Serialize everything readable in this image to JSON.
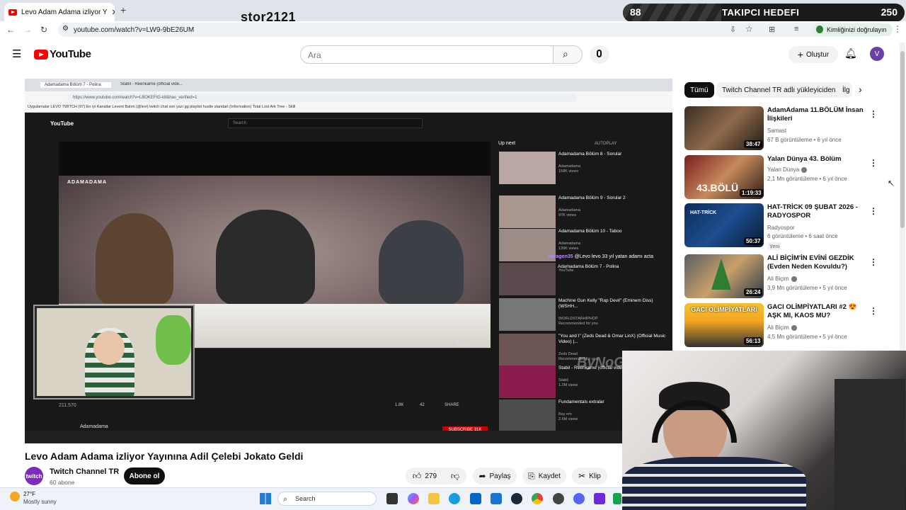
{
  "browser": {
    "tab_title": "Levo Adam Adama izliyor Y",
    "url": "youtube.com/watch?v=LW9-9bE26UM",
    "identity_chip": "Kimliğinizi doğrulayın"
  },
  "overlay": {
    "streamer_name": "stor2121",
    "follow_goal_label": "TAKIPCI HEDEFI",
    "follow_current": "88",
    "follow_target": "250",
    "follow_progress": 0.35
  },
  "youtube": {
    "logo": "YouTube",
    "search_placeholder": "Ara",
    "create_label": "Oluştur",
    "avatar_letter": "V"
  },
  "player": {
    "inner_url": "https://www.youtube.com/watch?v=LBOKEFIG-k8&has_verified=1",
    "inner_tab1": "Adamadama Bölüm 7 - Polina",
    "inner_tab2": "Stabil - Reenkarne (official vide...",
    "inner_bookmarks": "Uygulamalar   LEVO TWITCH   (97) En iyi Kanallar   Levent Balım (@levi)   twitch chat son yazı   gg   playlist   hustle standart   (Information) Total   Lost Ark Tree - Skill",
    "inner_search": "Search",
    "inner_logo": "YouTube",
    "up_next": "Up next",
    "autoplay": "AUTOPLAY",
    "sign": "ADAMADAMA",
    "watermark": "ByNoGame",
    "chat_line": "@Levo levo 33 yıl yatan adamı acta",
    "chat_user": "ravagen35",
    "chat_title": "Adamadama Bölüm 7 - Polina",
    "views_count": "211.570",
    "inner_channel": "Adamadama",
    "inner_likes": "1.8K",
    "inner_dislikes": "42",
    "inner_share": "SHARE",
    "inner_subscribe": "SUBSCRIBE 31K",
    "recs": [
      {
        "title": "Adamadama Bölüm 8 - Sorular",
        "sub": "Adamadama\n158K views",
        "dur": "15:35"
      },
      {
        "title": "Adamadama Bölüm 9 - Sorular 2",
        "sub": "Adamadama\n97K views",
        "dur": "8:29"
      },
      {
        "title": "Adamadama Bölüm 10 - Taboo",
        "sub": "Adamadama\n139K views",
        "dur": ""
      },
      {
        "title": "",
        "sub": "YouTube",
        "dur": "50+"
      },
      {
        "title": "Machine Gun Kelly \"Rap Devil\" (Eminem Diss) (WSHH...",
        "sub": "WORLDSTARHIPHOP\nRecommended for you",
        "dur": "4:48"
      },
      {
        "title": "\"You and I\" (Zeds Dead & Omar LinX) (Official Music Video) |...",
        "sub": "Zeds Dead\nRecommended for you",
        "dur": "4:18"
      },
      {
        "title": "Stabil - Reenkarne (official video)",
        "sub": "Stabil\n1.2M views",
        "dur": "5:22"
      },
      {
        "title": "Fundamentals extralar",
        "sub": "Bay em\n2.6M views",
        "dur": "35:58"
      }
    ]
  },
  "video": {
    "title": "Levo Adam Adama izliyor Yayınına Adil Çelebi Jokato Geldi",
    "channel_name": "Twitch Channel TR",
    "channel_subs": "60 abone",
    "channel_avatar_text": "twitch",
    "subscribe_label": "Abone ol",
    "like_count": "279",
    "share_label": "Paylaş",
    "save_label": "Kaydet",
    "clip_label": "Klip"
  },
  "filters": [
    "Tümü",
    "Twitch Channel TR adlı yükleyiciden",
    "İlg"
  ],
  "sidebar": [
    {
      "title": "AdamAdama 11.BÖLÜM İnsan İlişkileri",
      "channel": "Samast",
      "meta": "67 B görüntüleme • 6 yıl önce",
      "duration": "38:47",
      "verified": false,
      "badge": ""
    },
    {
      "title": "Yalan Dünya 43. Bölüm",
      "channel": "Yalan Dünya",
      "meta": "2,1 Mn görüntüleme • 6 yıl önce",
      "duration": "1:19:33",
      "verified": true,
      "badge": "",
      "thumb_text": "43.BÖLÜ"
    },
    {
      "title": "HAT-TRİCK 09 ŞUBAT 2026 - RADYOSPOR",
      "channel": "Radyospor",
      "meta": "6 görüntüleme • 6 saat önce",
      "duration": "50:37",
      "verified": false,
      "badge": "Yeni",
      "thumb_text": "HAT-TRİCK"
    },
    {
      "title": "ALİ BİÇİM'İN EVİNİ GEZDİK (Evden Neden Kovuldu?)",
      "channel": "Ali Biçim",
      "meta": "3,9 Mn görüntüleme • 5 yıl önce",
      "duration": "26:24",
      "verified": true,
      "badge": ""
    },
    {
      "title": "GACI OLİMPİYATLARI #2 😍 AŞK MI, KAOS MU?",
      "channel": "Ali Biçim",
      "meta": "4,5 Mn görüntüleme • 5 yıl önce",
      "duration": "56:13",
      "verified": true,
      "badge": "",
      "thumb_text": "GACI OLİMPİYATLARI"
    }
  ],
  "taskbar": {
    "temp": "27°F",
    "weather": "Mostly sunny",
    "search": "Search"
  },
  "colors": {
    "accent_red": "#ff0000",
    "dark": "#0f0f0f",
    "chip_bg": "#f2f2f2"
  }
}
